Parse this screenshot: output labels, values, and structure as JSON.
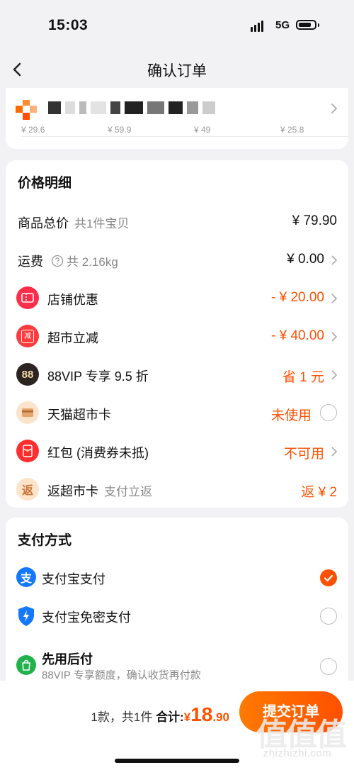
{
  "status_bar": {
    "time": "15:03",
    "network": "5G"
  },
  "nav": {
    "title": "确认订单"
  },
  "store": {
    "prices": [
      "¥ 29.6",
      "¥ 59.9",
      "¥ 49",
      "¥ 25.8"
    ]
  },
  "price_detail": {
    "title": "价格明细",
    "rows": [
      {
        "label": "商品总价",
        "sub": "共1件宝贝",
        "value": "¥ 79.90"
      },
      {
        "label": "运费",
        "sub": "共 2.16kg",
        "value": "¥ 0.00"
      },
      {
        "label": "店铺优惠",
        "value": "- ¥ 20.00"
      },
      {
        "label": "超市立减",
        "value": "- ¥ 40.00"
      },
      {
        "label": "88VIP 专享 9.5 折",
        "value": "省 1 元"
      },
      {
        "label": "天猫超市卡",
        "value": "未使用"
      },
      {
        "label": "红包 (消费券未抵)",
        "value": "不可用"
      },
      {
        "label": "返超市卡",
        "sub": "支付立返",
        "value": "返 ¥ 2"
      }
    ],
    "icons": {
      "vip": "88",
      "cashback": "返",
      "supermarket": "减"
    }
  },
  "payment": {
    "title": "支付方式",
    "options": [
      {
        "label": "支付宝支付",
        "selected": true
      },
      {
        "label": "支付宝免密支付",
        "selected": false
      },
      {
        "label": "先用后付",
        "desc": "88VIP 专享额度，确认收货再付款",
        "selected": false
      }
    ]
  },
  "bottom": {
    "count": "1款，共1件",
    "total_label": "合计:",
    "currency": "¥",
    "total_int": "18",
    "total_dec": ".90",
    "submit": "提交订单"
  },
  "watermark": {
    "text": "zhizhizhi.com",
    "logo": "值值值"
  },
  "colors": {
    "accent": "#ff5000",
    "background": "#f2f2f4"
  }
}
